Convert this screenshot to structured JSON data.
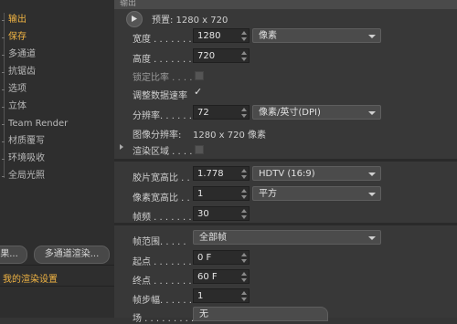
{
  "header": {
    "title": "输出"
  },
  "sidebar": {
    "items": [
      {
        "label": "输出",
        "active": true
      },
      {
        "label": "保存",
        "active": false
      },
      {
        "label": "多通道",
        "active": false
      },
      {
        "label": "抗锯齿",
        "active": false
      },
      {
        "label": "选项",
        "active": false
      },
      {
        "label": "立体",
        "active": false
      },
      {
        "label": "Team Render",
        "active": false
      },
      {
        "label": "材质覆写",
        "active": false
      },
      {
        "label": "环境吸收",
        "active": false
      },
      {
        "label": "全局光照",
        "active": false
      }
    ],
    "effect_button": "果...",
    "multipass_render_button": "多通道渲染...",
    "my_render_settings": "我的渲染设置"
  },
  "output": {
    "preset_label": "预置: 1280 x 720",
    "width_label": "宽度 . . . . . . .",
    "width_value": "1280",
    "unit_dropdown": "像素",
    "height_label": "高度 . . . . . . .",
    "height_value": "720",
    "lock_ratio_label": "锁定比率 . . . .",
    "adapt_data_rate_label": "调整数据速率",
    "adapt_data_rate_check": "✓",
    "resolution_label": "分辨率. . . . . .",
    "resolution_value": "72",
    "resolution_unit": "像素/英寸(DPI)",
    "image_resolution_label": "图像分辨率:",
    "image_resolution_value": "1280 x 720 像素",
    "render_region_label": "渲染区域 . . . .",
    "film_aspect_label": "胶片宽高比 . .",
    "film_aspect_value": "1.778",
    "film_aspect_preset": "HDTV (16:9)",
    "pixel_aspect_label": "像素宽高比 . .",
    "pixel_aspect_value": "1",
    "pixel_aspect_preset": "平方",
    "fps_label": "帧频 . . . . . . .",
    "fps_value": "30",
    "frame_range_label": "帧范围. . . . .",
    "frame_range_value": "全部帧",
    "start_label": "起点 . . . . . . .",
    "start_value": "0 F",
    "end_label": "终点 . . . . . . .",
    "end_value": "60 F",
    "frame_step_label": "帧步幅. . . . . .",
    "frame_step_value": "1",
    "field_label": "场 . . . . . . . . .",
    "field_value": "无"
  }
}
